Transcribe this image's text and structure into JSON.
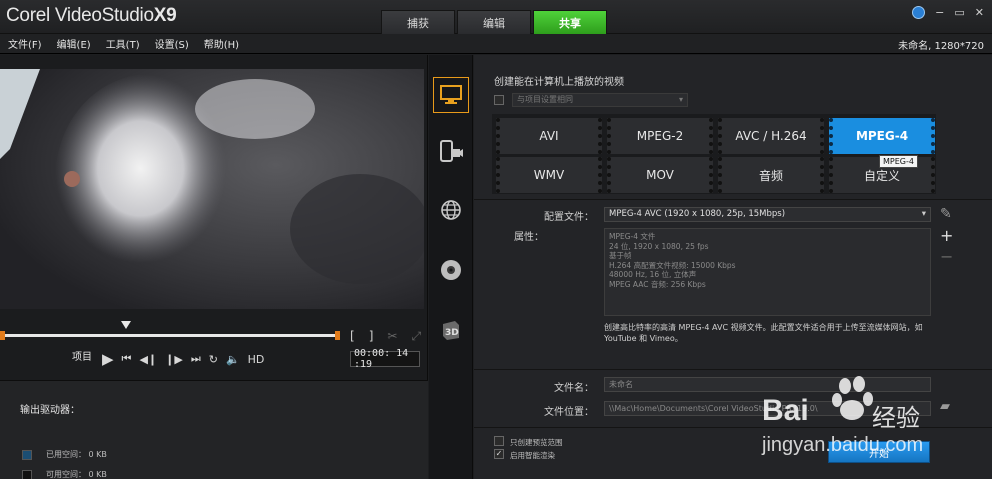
{
  "app": {
    "logo_main": "Corel VideoStudio",
    "logo_version": "X9",
    "project_info": "未命名, 1280*720"
  },
  "mode_tabs": [
    "捕获",
    "编辑",
    "共享"
  ],
  "active_mode": 2,
  "window_controls": {
    "minimize": "−",
    "restore": "▭",
    "close": "✕"
  },
  "menu": [
    "文件(F)",
    "编辑(E)",
    "工具(T)",
    "设置(S)",
    "帮助(H)"
  ],
  "player": {
    "project_label": "项目",
    "mark_in": "[",
    "mark_out": "]",
    "hd_label": "HD",
    "timecode": "00:00: 14 :19"
  },
  "drive": {
    "title": "输出驱动器：",
    "used": "已用空间： 0 KB",
    "free": "可用空间： 0 KB",
    "used_color": "#1c4e73",
    "free_color": "#111111"
  },
  "categories": [
    "computer-icon",
    "mobile-device-icon",
    "web-globe-icon",
    "disc-icon",
    "3d-icon"
  ],
  "share": {
    "title": "创建能在计算机上播放的视频",
    "preset_placeholder": "与项目设置相同",
    "formats": [
      "AVI",
      "MPEG-2",
      "AVC / H.264",
      "MPEG-4",
      "WMV",
      "MOV",
      "音频",
      "自定义"
    ],
    "selected_format": "MPEG-4",
    "tooltip": "MPEG-4",
    "profile_label": "配置文件：",
    "profile_value": "MPEG-4 AVC (1920 x 1080, 25p, 15Mbps)",
    "attr_label": "属性：",
    "attributes": [
      "MPEG-4 文件",
      "24 位, 1920 x 1080, 25 fps",
      "基于帧",
      "H.264 高配置文件视频: 15000 Kbps",
      "48000 Hz, 16 位, 立体声",
      "MPEG AAC 音频: 256 Kbps"
    ],
    "description": "创建高比特率的高清 MPEG-4 AVC 视频文件。此配置文件适合用于上传至流媒体网站，如 YouTube 和 Vimeo。",
    "filename_label": "文件名：",
    "filename_value": "未命名",
    "location_label": "文件位置：",
    "location_value": "\\\\Mac\\Home\\Documents\\Corel VideoStudio Pro\\19.0\\",
    "option_render_range": "只创建预览范围",
    "option_smart_render": "启用智能渲染",
    "start_label": "开始"
  },
  "watermark": {
    "brand": "Bai",
    "brand_cn": "经验",
    "url": "jingyan.baidu.com"
  }
}
